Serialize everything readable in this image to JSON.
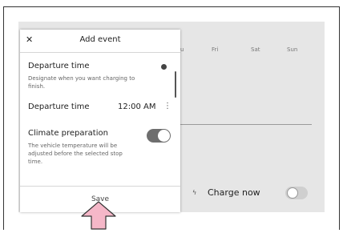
{
  "dialog": {
    "close_icon": "close-icon",
    "title": "Add event",
    "departure_time_heading": "Departure time",
    "departure_time_description": "Designate when you want charging to finish.",
    "departure_time_label": "Departure time",
    "departure_time_value": "12:00 AM",
    "departure_time_menu": "⋮",
    "climate_label": "Climate preparation",
    "climate_description": "The vehicle temperature will be adjusted before the selected stop time.",
    "climate_enabled": true,
    "save_label": "Save"
  },
  "background": {
    "days": [
      "u",
      "Fri",
      "Sat",
      "Sun"
    ],
    "charge_now_label": "Charge now",
    "charge_now_icon": "bolt-icon",
    "charge_now_enabled": false
  },
  "annotation": {
    "arrow_icon": "up-arrow-icon",
    "arrow_color": "#f5b7c8"
  }
}
